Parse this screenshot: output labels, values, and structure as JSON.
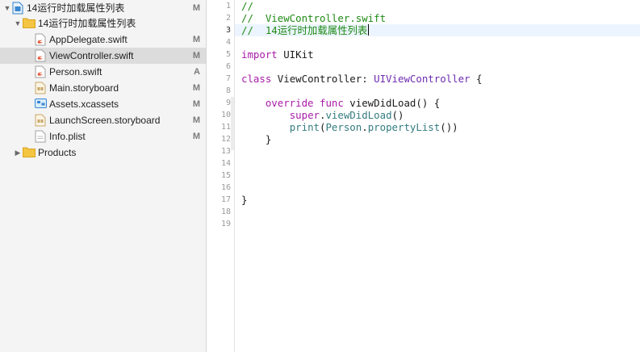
{
  "navigator": {
    "items": [
      {
        "label": "14运行时加载属性列表",
        "status": "M",
        "icon": "project-file-icon",
        "disclosure": "▼"
      },
      {
        "label": "14运行时加载属性列表",
        "status": "",
        "icon": "folder-icon",
        "disclosure": "▼"
      },
      {
        "label": "AppDelegate.swift",
        "status": "M",
        "icon": "swift-file-icon"
      },
      {
        "label": "ViewController.swift",
        "status": "M",
        "icon": "swift-file-icon",
        "selected": true
      },
      {
        "label": "Person.swift",
        "status": "A",
        "icon": "swift-file-icon"
      },
      {
        "label": "Main.storyboard",
        "status": "M",
        "icon": "storyboard-file-icon"
      },
      {
        "label": "Assets.xcassets",
        "status": "M",
        "icon": "asset-catalog-icon"
      },
      {
        "label": "LaunchScreen.storyboard",
        "status": "M",
        "icon": "storyboard-file-icon"
      },
      {
        "label": "Info.plist",
        "status": "M",
        "icon": "plist-file-icon"
      },
      {
        "label": "Products",
        "status": "",
        "icon": "folder-icon",
        "disclosure": "▶"
      }
    ]
  },
  "editor": {
    "current_line": 3,
    "line_numbers": [
      "1",
      "2",
      "3",
      "4",
      "5",
      "6",
      "7",
      "8",
      "9",
      "10",
      "11",
      "12",
      "13",
      "14",
      "15",
      "16",
      "17",
      "18",
      "19"
    ],
    "lines": [
      [
        {
          "t": "//",
          "c": "comment"
        }
      ],
      [
        {
          "t": "//  ViewController.swift",
          "c": "comment"
        }
      ],
      [
        {
          "t": "//  14运行时加载属性列表",
          "c": "comment"
        }
      ],
      [],
      [
        {
          "t": "import",
          "c": "keyword"
        },
        {
          "t": " UIKit",
          "c": "plain"
        }
      ],
      [],
      [
        {
          "t": "class",
          "c": "keyword"
        },
        {
          "t": " ViewController: ",
          "c": "plain"
        },
        {
          "t": "UIViewController",
          "c": "type"
        },
        {
          "t": " {",
          "c": "plain"
        }
      ],
      [],
      [
        {
          "t": "    ",
          "c": "plain"
        },
        {
          "t": "override",
          "c": "keyword"
        },
        {
          "t": " ",
          "c": "plain"
        },
        {
          "t": "func",
          "c": "keyword"
        },
        {
          "t": " viewDidLoad() {",
          "c": "plain"
        }
      ],
      [
        {
          "t": "        ",
          "c": "plain"
        },
        {
          "t": "super",
          "c": "keyword"
        },
        {
          "t": ".",
          "c": "plain"
        },
        {
          "t": "viewDidLoad",
          "c": "project"
        },
        {
          "t": "()",
          "c": "plain"
        }
      ],
      [
        {
          "t": "        ",
          "c": "plain"
        },
        {
          "t": "print",
          "c": "project"
        },
        {
          "t": "(",
          "c": "plain"
        },
        {
          "t": "Person",
          "c": "project"
        },
        {
          "t": ".",
          "c": "plain"
        },
        {
          "t": "propertyList",
          "c": "project"
        },
        {
          "t": "())",
          "c": "plain"
        }
      ],
      [
        {
          "t": "    }",
          "c": "plain"
        }
      ],
      [],
      [],
      [],
      [],
      [
        {
          "t": "}",
          "c": "plain"
        }
      ],
      [],
      []
    ]
  },
  "colors": {
    "comment": "#1f8a14",
    "keyword": "#a81ba8",
    "type": "#6e2bb0",
    "project": "#347c80",
    "selection": "#dcdcdc",
    "current_line": "#ecf5ff"
  }
}
